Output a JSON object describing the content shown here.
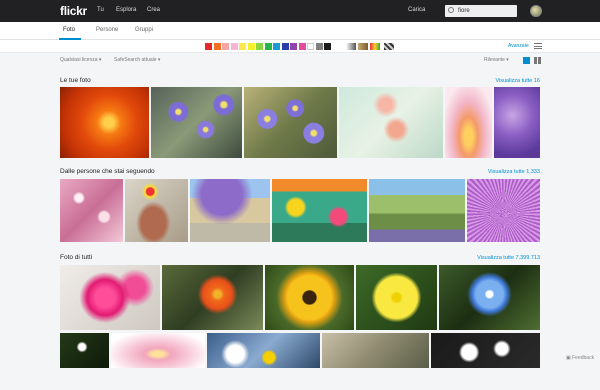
{
  "header": {
    "logo": "flickr",
    "nav": [
      "Tu",
      "Esplora",
      "Crea"
    ],
    "upload_label": "Carica",
    "search_value": "fiore"
  },
  "tabs": [
    "Foto",
    "Persone",
    "Gruppi"
  ],
  "filter": {
    "colors": [
      "#e8262d",
      "#f36f21",
      "#f6a4a6",
      "#f7b5d3",
      "#fde74c",
      "#f5f12d",
      "#8ad43f",
      "#25b34b",
      "#1c9ad6",
      "#2b3fa8",
      "#8e44ad",
      "#e54aa1",
      "#ffffff",
      "#7f7f7f",
      "#1b1b1b"
    ],
    "advanced_label": "Avanzate"
  },
  "controls": {
    "license": "Qualsiasi licenza",
    "safesearch": "SafeSearch attuale",
    "sort": "Rilevante"
  },
  "sections": [
    {
      "title": "Le tue foto",
      "link": "Visualizza tutte 16"
    },
    {
      "title": "Dalle persone che stai seguendo",
      "link": "Visualizza tutte 1.333"
    },
    {
      "title": "Foto di tutti",
      "link": "Visualizza tutte 7.399.713"
    }
  ],
  "feedback_label": "Feedback"
}
